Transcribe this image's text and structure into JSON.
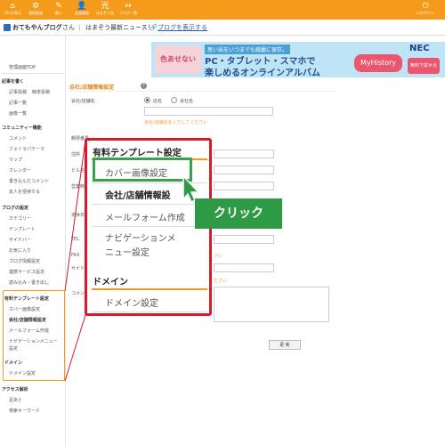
{
  "topbar": {
    "items": [
      {
        "icon": "home-icon",
        "glyph": "⌂",
        "label": "ブログ表示"
      },
      {
        "icon": "settings-icon",
        "glyph": "⚙",
        "label": "管理画面"
      },
      {
        "icon": "pen-icon",
        "glyph": "✎",
        "label": "書く"
      },
      {
        "icon": "user-icon",
        "glyph": "👤",
        "label": "会員情報"
      },
      {
        "icon": "light-icon",
        "glyph": "光",
        "label": "はまぞう光"
      },
      {
        "icon": "arrows-icon",
        "glyph": "↔",
        "label": "ブログ一覧"
      }
    ],
    "logout_label": "ログアウト"
  },
  "subbar": {
    "username": "おてもやんブログ",
    "suffix": "さん",
    "news": "はまぞう最新ニュース！",
    "show_blog_link": "ブログを表示する"
  },
  "banner": {
    "left_badge": "色あせない",
    "line1": "思い出をいつまでも綺麗に保存。",
    "line2": "PC・タブレット・スマホで",
    "line3": "楽しめるオンラインアルバム",
    "brand": "MyHistory",
    "logo": "NEC",
    "free": "無料で試せる"
  },
  "sidebar": {
    "top_item": "管理画面TOP",
    "sections": [
      {
        "title": "記事を書く",
        "items": [
          "記事投稿",
          "簡単投稿",
          "記事一覧",
          "画像一覧"
        ]
      },
      {
        "title": "コミュニティー機能",
        "items": [
          "コメント",
          "フォトラパテーマ",
          "マップ",
          "カレンダー",
          "書き込んだコメント",
          "友人を招待する"
        ]
      },
      {
        "title": "ブログの設定",
        "items": [
          "カテゴリー",
          "テンプレート",
          "サイドバー",
          "お気に入り",
          "ブログ情報設定",
          "連携サービス設定",
          "読み込み・書き出し"
        ]
      },
      {
        "title": "有料テンプレート設定",
        "items": [
          "カバー画像設定",
          "会社/店舗情報設定",
          "メールフォーム作成",
          "ナビゲーションメニュー設定"
        ]
      },
      {
        "title": "ドメイン",
        "items": [
          "ドメイン設定"
        ]
      },
      {
        "title": "アクセス解析",
        "items": [
          "足あと",
          "検索キーワード"
        ]
      }
    ]
  },
  "form": {
    "title": "会社/店舗情報設定",
    "help": "?",
    "company_label": "会社/店舗名",
    "radio_store": "店名",
    "radio_company": "会社名",
    "company_hint": "会社/店舗名を入力してください",
    "postal_label": "郵便番号",
    "address_label": "住所",
    "building_label": "ビル名",
    "hours_label": "営業時間",
    "holiday_label": "定休日",
    "tel_label": "TEL",
    "fax_label": "FAX",
    "site_label": "サイト",
    "comment_label": "コメント",
    "hint_tail": "ださい",
    "hint_tail2": "さい",
    "submit": "更 新"
  },
  "popup": {
    "head1": "有料テンプレート設定",
    "items": [
      "カバー画像設定",
      "会社/店舗情報設",
      "メールフォーム作成",
      "ナビゲーションメ",
      "ニュー設定"
    ],
    "head2": "ドメイン",
    "domain_item": "ドメイン設定"
  },
  "annotation": {
    "click_label": "クリック"
  },
  "colors": {
    "accent": "#f49b1c",
    "popup_border": "#d81b2c",
    "highlight": "#3aa24a",
    "click_bg": "#2e9a46"
  }
}
